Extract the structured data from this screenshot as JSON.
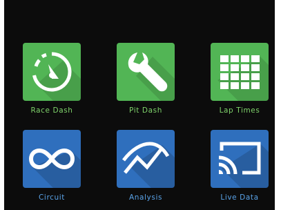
{
  "apps": [
    {
      "label": "Race Dash",
      "icon": "race-dash-stopwatch-icon",
      "color": "#52b555"
    },
    {
      "label": "Pit Dash",
      "icon": "wrench-icon",
      "color": "#52b555"
    },
    {
      "label": "Lap Times",
      "icon": "grid-table-icon",
      "color": "#52b555"
    },
    {
      "label": "Circuit",
      "icon": "infinity-loop-icon",
      "color": "#2f6fbd"
    },
    {
      "label": "Analysis",
      "icon": "trend-chart-icon",
      "color": "#2f6fbd"
    },
    {
      "label": "Live Data",
      "icon": "cast-screen-icon",
      "color": "#2f6fbd"
    }
  ]
}
